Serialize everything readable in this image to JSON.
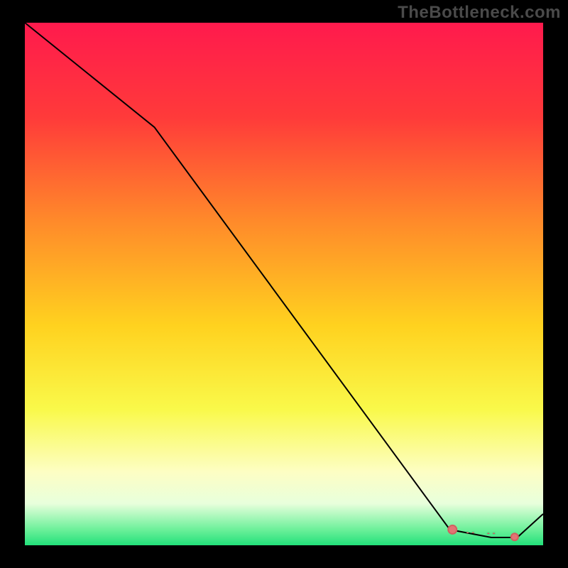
{
  "watermark": "TheBottleneck.com",
  "colors": {
    "line": "#000000",
    "marker_stroke": "#d16060",
    "marker_fill": "#e27474",
    "dash_text": "#d16060"
  },
  "chart_data": {
    "type": "line",
    "title": "",
    "xlabel": "",
    "ylabel": "",
    "xlim": [
      0,
      100
    ],
    "ylim": [
      0,
      100
    ],
    "gradient_stops": [
      {
        "offset": 0,
        "color": "#ff1a4d"
      },
      {
        "offset": 0.18,
        "color": "#ff3a3a"
      },
      {
        "offset": 0.38,
        "color": "#ff8a2a"
      },
      {
        "offset": 0.58,
        "color": "#ffd21f"
      },
      {
        "offset": 0.74,
        "color": "#f9f94a"
      },
      {
        "offset": 0.86,
        "color": "#fdfec4"
      },
      {
        "offset": 0.92,
        "color": "#e8ffdc"
      },
      {
        "offset": 0.97,
        "color": "#6cf09a"
      },
      {
        "offset": 1.0,
        "color": "#22e07a"
      }
    ],
    "series": [
      {
        "name": "curve",
        "x": [
          0,
          25,
          82,
          90,
          95,
          100
        ],
        "y": [
          100,
          80,
          3,
          1.5,
          1.5,
          6
        ]
      }
    ],
    "markers": [
      {
        "x": 82.5,
        "y": 3.0
      },
      {
        "x": 94.5,
        "y": 1.6
      }
    ],
    "annotations": [
      {
        "x": 86,
        "y": 2.2,
        "text": "- -"
      },
      {
        "x": 90,
        "y": 2.0,
        "text": "- -"
      }
    ]
  }
}
